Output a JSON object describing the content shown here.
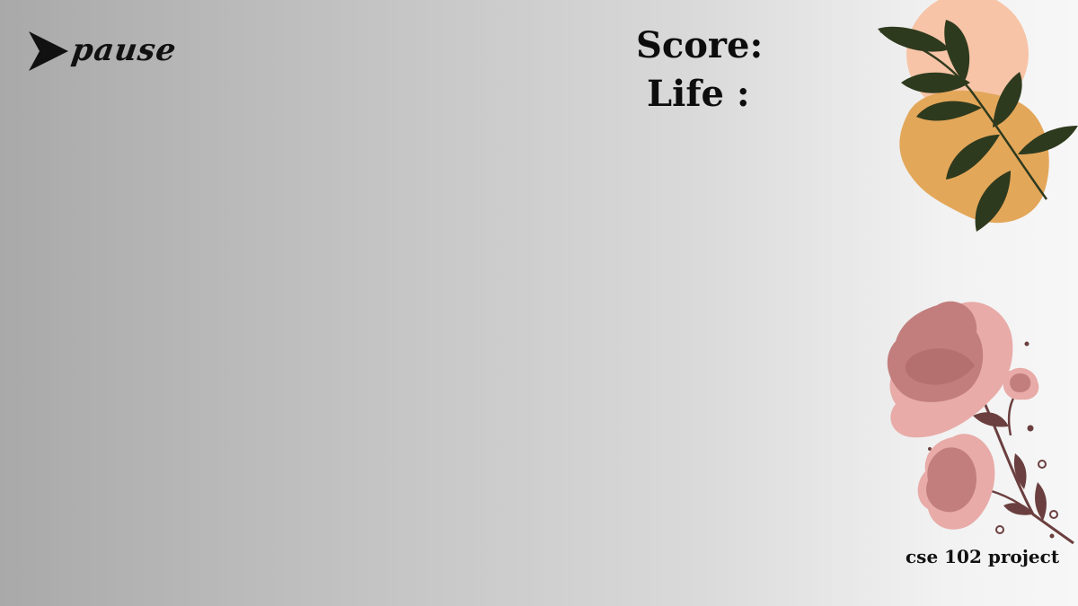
{
  "pause_button": {
    "label": "pause",
    "icon": "play-arrow-icon"
  },
  "hud": {
    "score_label": "Score:",
    "life_label": "Life :"
  },
  "decorations": {
    "leaf": "leaf-branch-icon",
    "flowers": "flower-branch-icon"
  },
  "footer": {
    "label": "cse 102 project"
  },
  "colors": {
    "text": "#111111",
    "peach": "#f7c4a7",
    "orange": "#e3a75a",
    "leaf": "#2e3a1e",
    "flower_dark": "#c27e7d",
    "flower_light": "#e8aba8",
    "stem": "#6b3f3f"
  }
}
